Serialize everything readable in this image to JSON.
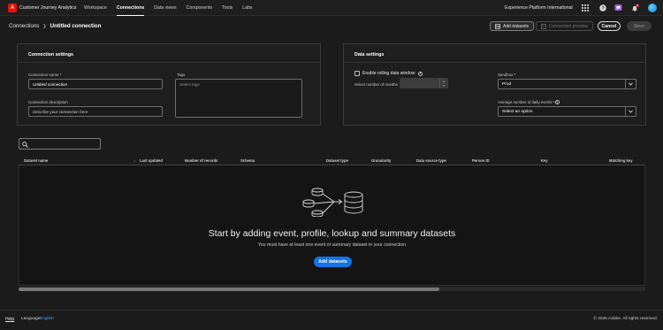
{
  "topbar": {
    "logo_letter": "A",
    "app_name": "Customer Journey Analytics",
    "nav": [
      {
        "label": "Workspace",
        "active": false
      },
      {
        "label": "Connections",
        "active": true
      },
      {
        "label": "Data views",
        "active": false
      },
      {
        "label": "Components",
        "active": false
      },
      {
        "label": "Tools",
        "active": false
      },
      {
        "label": "Labs",
        "active": false
      }
    ],
    "org_name": "Experience Platform International",
    "notification_count": "1",
    "icons": [
      "apps-grid-icon",
      "help-icon",
      "announcements-icon",
      "notifications-bell-icon",
      "avatar"
    ]
  },
  "breadcrumb": {
    "parent": "Connections",
    "current": "Untitled connection"
  },
  "actions": {
    "add_datasets": "Add datasets",
    "connection_preview": "Connection preview",
    "cancel": "Cancel",
    "save": "Save"
  },
  "connection_settings": {
    "title": "Connection settings",
    "name_label": "Connection name",
    "name_value": "Untitled connection",
    "description_label": "Connection description",
    "description_placeholder": "Describe your connection here",
    "tags_label": "Tags",
    "tags_placeholder": "Select tags",
    "required_mark": "*"
  },
  "data_settings": {
    "title": "Data settings",
    "rolling_window_label": "Enable rolling data window",
    "months_label": "Select number of months",
    "sandbox_label": "Sandbox",
    "sandbox_value": "Prod",
    "daily_events_label": "Average number of daily events",
    "daily_events_placeholder": "Select an option",
    "required_mark": "*",
    "info_glyph": "i"
  },
  "table": {
    "columns": [
      "Dataset name",
      "Last updated",
      "Number of records",
      "Schema",
      "Dataset type",
      "Granularity",
      "Data source type",
      "Person ID",
      "Key",
      "Matching key"
    ],
    "sort_indicator": "↓",
    "empty_title": "Start by adding event, profile, lookup and summary datasets",
    "empty_subtitle": "You must have at least one event or summary dataset in your connection",
    "empty_button": "Add datasets"
  },
  "footer": {
    "help": "Help",
    "language_label": "Language:",
    "language_value": "English",
    "copyright": "© 2025 Adobe. All rights reserved."
  },
  "colors": {
    "accent": "#1473e6",
    "adobe_red": "#eb1000",
    "background": "#1b1b1b"
  }
}
